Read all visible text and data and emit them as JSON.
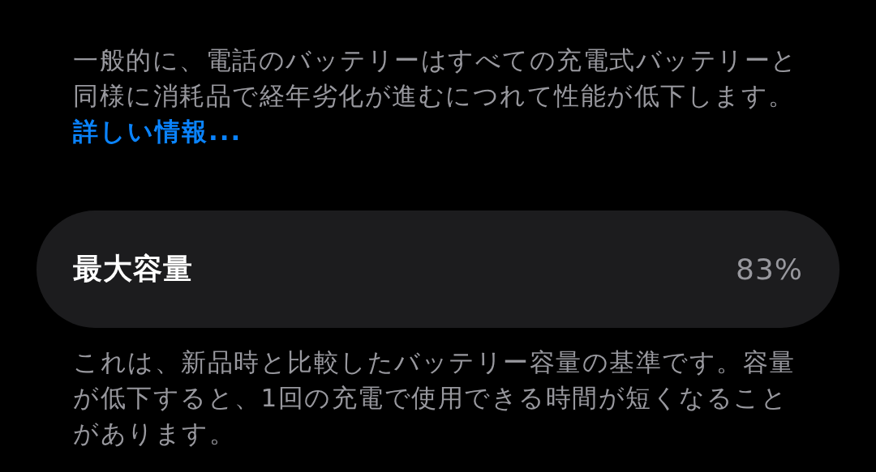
{
  "intro": {
    "text": "一般的に、電話のバッテリーはすべての充電式バッテリーと同様に消耗品で経年劣化が進むにつれて性能が低下します。",
    "link": "詳しい情報..."
  },
  "capacity": {
    "label": "最大容量",
    "value": "83%"
  },
  "footnote": "これは、新品時と比較したバッテリー容量の基準です。容量が低下すると、1回の充電で使用できる時間が短くなることがあります。"
}
